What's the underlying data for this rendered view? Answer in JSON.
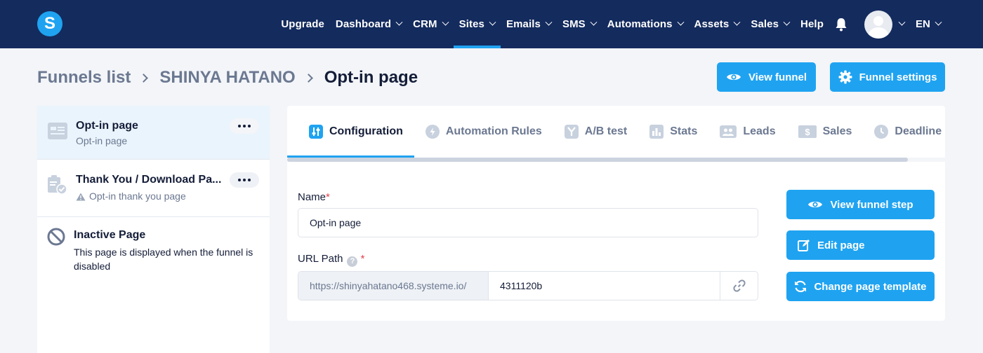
{
  "brand": {
    "logo_letter": "S",
    "accent": "#1fa3f1",
    "nav_bg": "#142b5e"
  },
  "nav": {
    "items": [
      {
        "label": "Upgrade",
        "has_dropdown": false
      },
      {
        "label": "Dashboard",
        "has_dropdown": true
      },
      {
        "label": "CRM",
        "has_dropdown": true
      },
      {
        "label": "Sites",
        "has_dropdown": true,
        "active": true
      },
      {
        "label": "Emails",
        "has_dropdown": true
      },
      {
        "label": "SMS",
        "has_dropdown": true
      },
      {
        "label": "Automations",
        "has_dropdown": true
      },
      {
        "label": "Assets",
        "has_dropdown": true
      },
      {
        "label": "Sales",
        "has_dropdown": true
      },
      {
        "label": "Help",
        "has_dropdown": false
      }
    ],
    "notifications_icon": "bell-icon",
    "language": "EN"
  },
  "breadcrumb": {
    "items": [
      "Funnels list",
      "SHINYA HATANO",
      "Opt-in page"
    ]
  },
  "header_actions": {
    "view_funnel": "View funnel",
    "funnel_settings": "Funnel settings"
  },
  "sidebar": {
    "steps": [
      {
        "title": "Opt-in page",
        "subtitle": "Opt-in page",
        "icon": "page-layout-icon",
        "selected": true
      },
      {
        "title": "Thank You / Download Pa...",
        "subtitle": "Opt-in thank you page",
        "icon": "clipboard-check-icon",
        "warning": true
      },
      {
        "title": "Inactive Page",
        "subtitle": "This page is displayed when the funnel is disabled",
        "icon": "ban-icon"
      }
    ]
  },
  "tabs": [
    {
      "label": "Configuration",
      "icon": "sliders-icon",
      "active": true
    },
    {
      "label": "Automation Rules",
      "icon": "bolt-icon"
    },
    {
      "label": "A/B test",
      "icon": "split-icon"
    },
    {
      "label": "Stats",
      "icon": "bar-chart-icon"
    },
    {
      "label": "Leads",
      "icon": "users-icon"
    },
    {
      "label": "Sales",
      "icon": "dollar-icon"
    },
    {
      "label": "Deadline set",
      "icon": "clock-icon"
    }
  ],
  "form": {
    "name_label": "Name",
    "name_required": "*",
    "name_value": "Opt-in page",
    "url_label": "URL Path",
    "url_help": "?",
    "url_required": "*",
    "url_prefix": "https://shinyahatano468.systeme.io/",
    "url_value": "4311120b"
  },
  "side_actions": {
    "view_step": "View funnel step",
    "edit_page": "Edit page",
    "change_template": "Change page template"
  }
}
